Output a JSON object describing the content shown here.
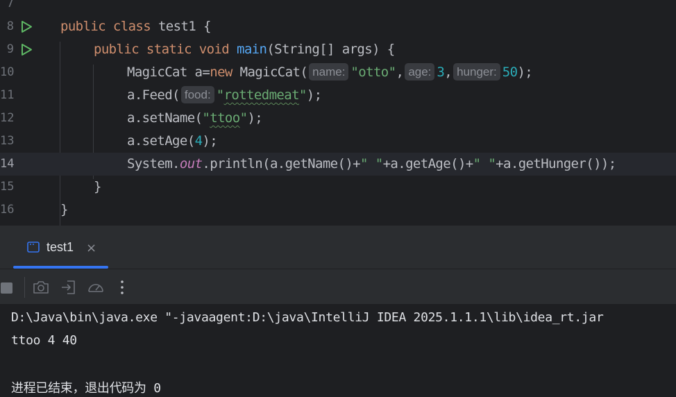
{
  "editor": {
    "lines": [
      {
        "number": "7"
      },
      {
        "number": "8"
      },
      {
        "number": "9"
      },
      {
        "number": "10"
      },
      {
        "number": "11"
      },
      {
        "number": "12"
      },
      {
        "number": "13"
      },
      {
        "number": "14"
      },
      {
        "number": "15"
      },
      {
        "number": "16"
      }
    ],
    "current_line": "14",
    "run_gutter_icons": [
      "run-icon",
      "run-icon"
    ],
    "code": {
      "l8": {
        "kw1": "public",
        "kw2": "class",
        "rest": "test1 {"
      },
      "l9": {
        "kw1": "public",
        "kw2": "static",
        "kw3": "void",
        "fn": "main",
        "rest": "(String[] args) {"
      },
      "l10": {
        "pre": "MagicCat a=",
        "kw": "new",
        "ctor": "MagicCat(",
        "hint_name": "name:",
        "str_name": "\"otto\"",
        "comma1": ",",
        "hint_age": "age:",
        "num_age": "3",
        "comma2": ",",
        "hint_hunger": "hunger:",
        "num_hunger": "50",
        "close": ");"
      },
      "l11": {
        "pre": "a.Feed(",
        "hint_food": "food:",
        "str_q1": "\"",
        "str_word": "rottedmeat",
        "str_q2": "\"",
        "close": ");"
      },
      "l12": {
        "pre": "a.setName(",
        "str_q1": "\"",
        "str_word": "ttoo",
        "str_q2": "\"",
        "close": ");"
      },
      "l13": {
        "pre": "a.setAge(",
        "num": "4",
        "close": ");"
      },
      "l14": {
        "pre": "System.",
        "field": "out",
        "post": ".println(a.getName()+",
        "str1": "\" \"",
        "mid": "+a.getAge()+",
        "str2": "\" \"",
        "end": "+a.getHunger());"
      },
      "l15": {
        "text": "}"
      },
      "l16": {
        "text": "}"
      }
    }
  },
  "run_panel": {
    "tab_label": "test1",
    "tab_close": "×",
    "toolbar_icons": [
      "stop-icon",
      "camera-icon",
      "login-icon",
      "gauge-icon",
      "more-vertical-icon"
    ]
  },
  "console": {
    "lines": [
      "D:\\Java\\bin\\java.exe \"-javaagent:D:\\java\\IntelliJ IDEA 2025.1.1.1\\lib\\idea_rt.jar",
      "ttoo 4 40",
      "",
      "进程已结束，退出代码为 0"
    ]
  },
  "colors": {
    "editor_bg": "#1e1f22",
    "panel_bg": "#2b2d30",
    "keyword": "#cf8e6d",
    "function": "#56a8f5",
    "string": "#6aab73",
    "number": "#2aacb8",
    "static_field": "#c77dbb",
    "run_green": "#5fb865",
    "accent": "#3574f0"
  }
}
